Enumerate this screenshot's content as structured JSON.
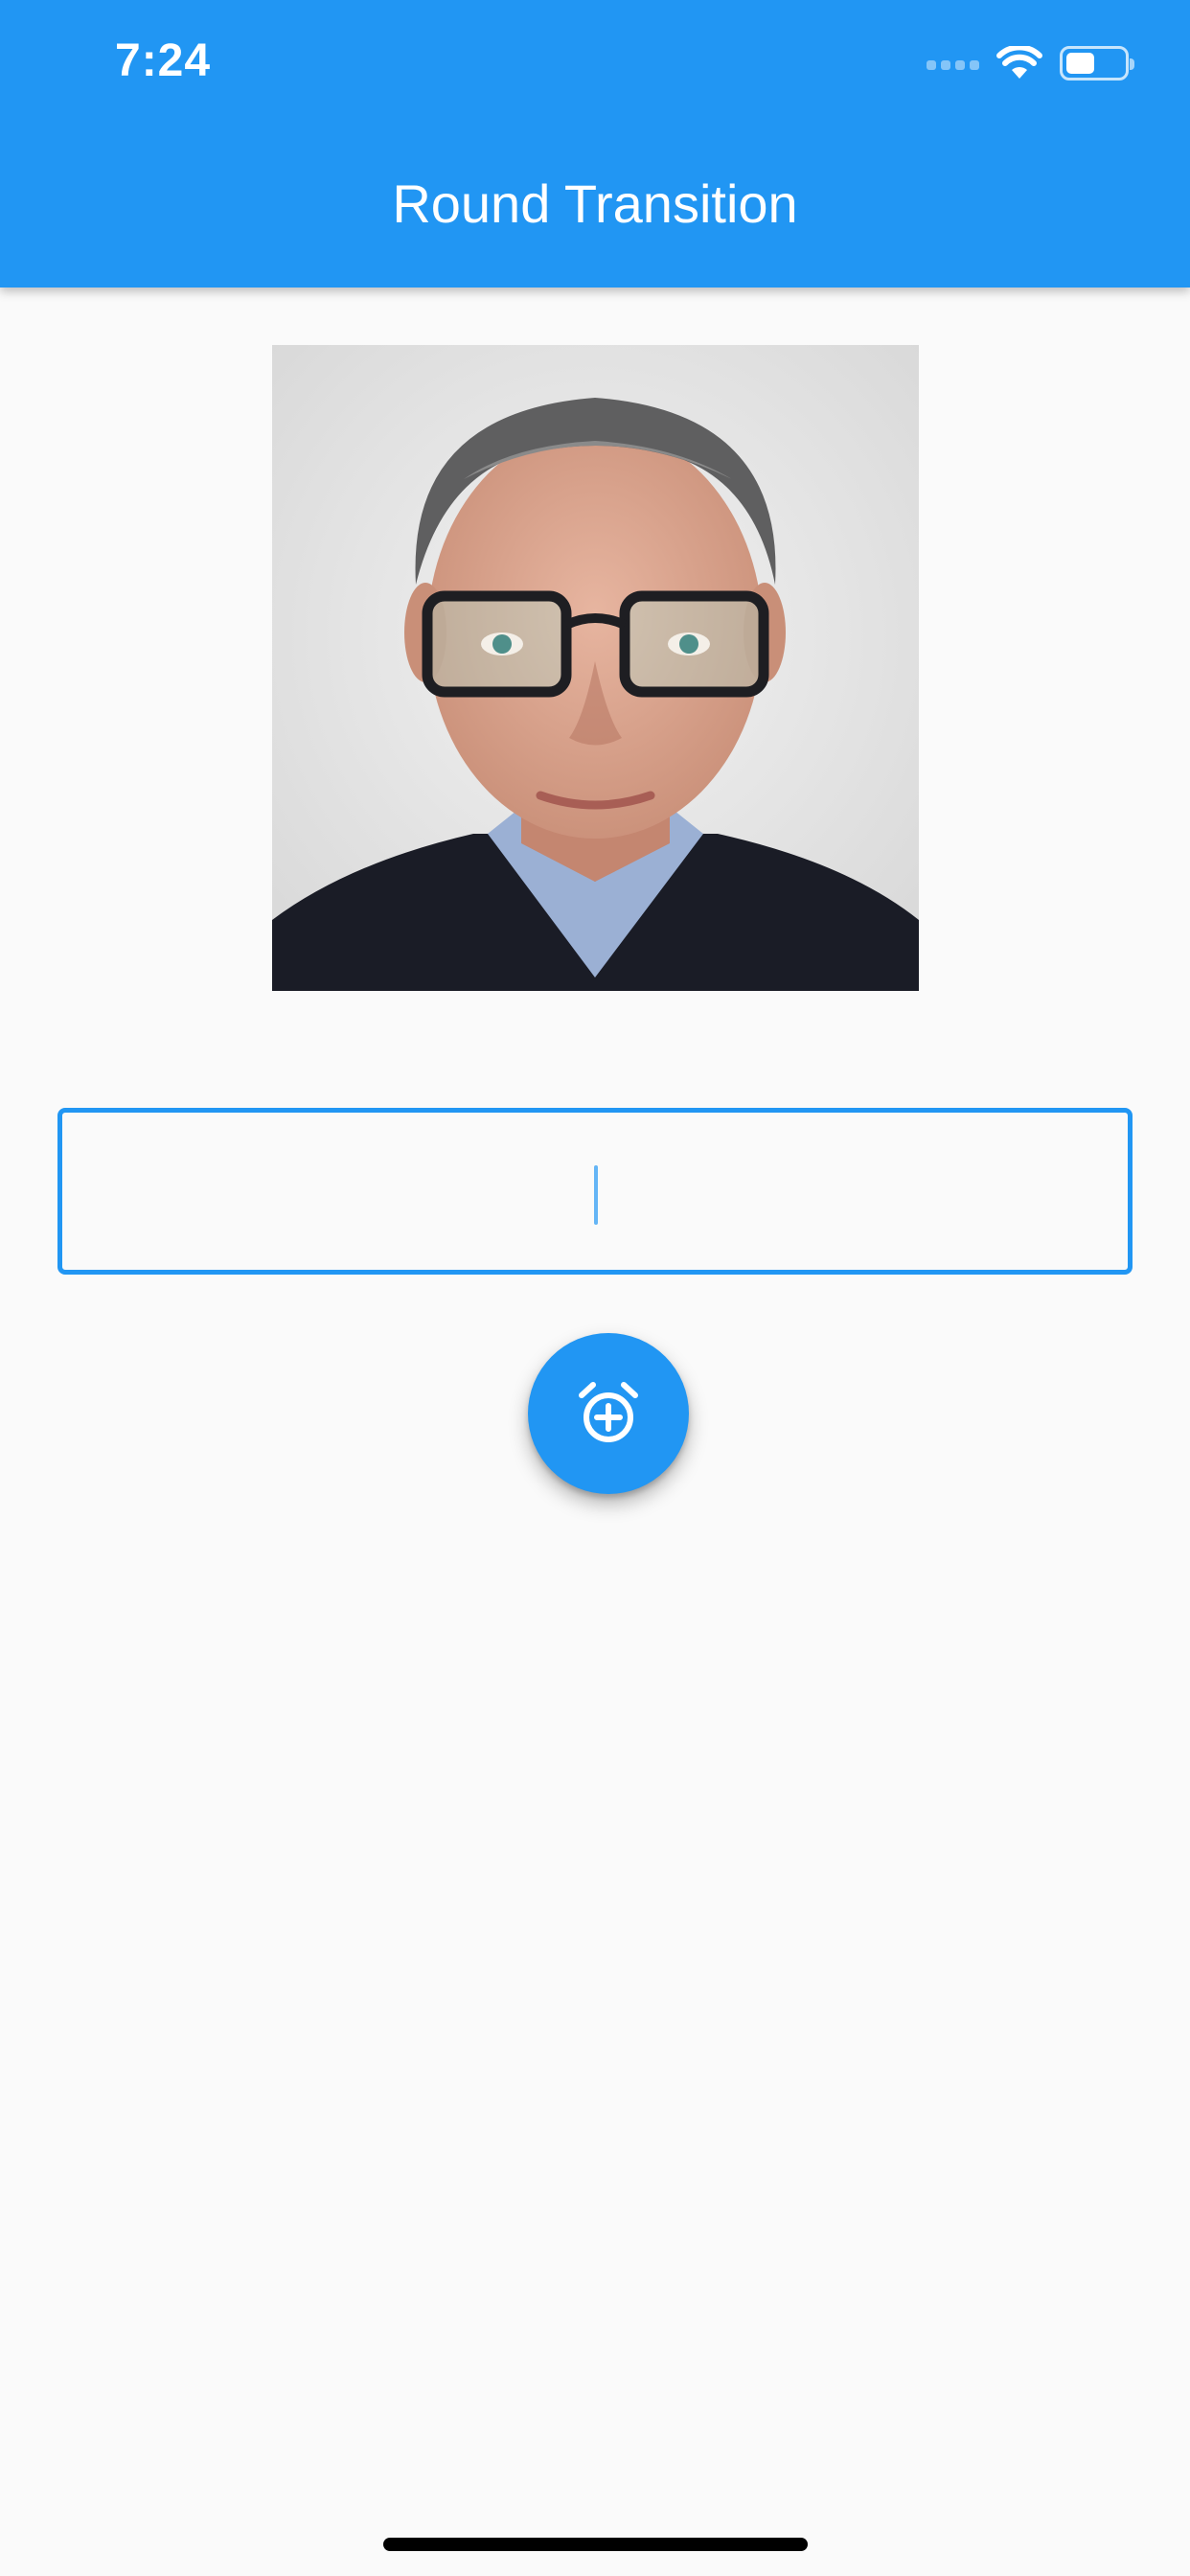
{
  "status_bar": {
    "time": "7:24",
    "battery_level": 0.5
  },
  "app_bar": {
    "title": "Round Transition"
  },
  "text_field": {
    "value": "",
    "placeholder": ""
  },
  "fab": {
    "icon": "add-alarm-icon"
  },
  "colors": {
    "primary": "#2196f3",
    "background": "#fafafa"
  }
}
